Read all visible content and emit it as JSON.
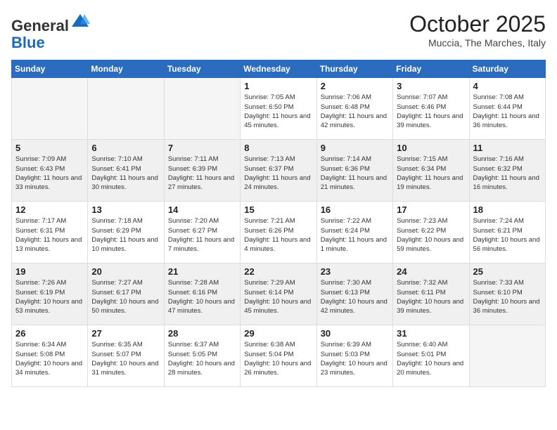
{
  "header": {
    "logo_line1": "General",
    "logo_line2": "Blue",
    "month_title": "October 2025",
    "location": "Muccia, The Marches, Italy"
  },
  "weekdays": [
    "Sunday",
    "Monday",
    "Tuesday",
    "Wednesday",
    "Thursday",
    "Friday",
    "Saturday"
  ],
  "weeks": [
    {
      "shaded": false,
      "days": [
        {
          "num": "",
          "info": ""
        },
        {
          "num": "",
          "info": ""
        },
        {
          "num": "",
          "info": ""
        },
        {
          "num": "1",
          "info": "Sunrise: 7:05 AM\nSunset: 6:50 PM\nDaylight: 11 hours and 45 minutes."
        },
        {
          "num": "2",
          "info": "Sunrise: 7:06 AM\nSunset: 6:48 PM\nDaylight: 11 hours and 42 minutes."
        },
        {
          "num": "3",
          "info": "Sunrise: 7:07 AM\nSunset: 6:46 PM\nDaylight: 11 hours and 39 minutes."
        },
        {
          "num": "4",
          "info": "Sunrise: 7:08 AM\nSunset: 6:44 PM\nDaylight: 11 hours and 36 minutes."
        }
      ]
    },
    {
      "shaded": true,
      "days": [
        {
          "num": "5",
          "info": "Sunrise: 7:09 AM\nSunset: 6:43 PM\nDaylight: 11 hours and 33 minutes."
        },
        {
          "num": "6",
          "info": "Sunrise: 7:10 AM\nSunset: 6:41 PM\nDaylight: 11 hours and 30 minutes."
        },
        {
          "num": "7",
          "info": "Sunrise: 7:11 AM\nSunset: 6:39 PM\nDaylight: 11 hours and 27 minutes."
        },
        {
          "num": "8",
          "info": "Sunrise: 7:13 AM\nSunset: 6:37 PM\nDaylight: 11 hours and 24 minutes."
        },
        {
          "num": "9",
          "info": "Sunrise: 7:14 AM\nSunset: 6:36 PM\nDaylight: 11 hours and 21 minutes."
        },
        {
          "num": "10",
          "info": "Sunrise: 7:15 AM\nSunset: 6:34 PM\nDaylight: 11 hours and 19 minutes."
        },
        {
          "num": "11",
          "info": "Sunrise: 7:16 AM\nSunset: 6:32 PM\nDaylight: 11 hours and 16 minutes."
        }
      ]
    },
    {
      "shaded": false,
      "days": [
        {
          "num": "12",
          "info": "Sunrise: 7:17 AM\nSunset: 6:31 PM\nDaylight: 11 hours and 13 minutes."
        },
        {
          "num": "13",
          "info": "Sunrise: 7:18 AM\nSunset: 6:29 PM\nDaylight: 11 hours and 10 minutes."
        },
        {
          "num": "14",
          "info": "Sunrise: 7:20 AM\nSunset: 6:27 PM\nDaylight: 11 hours and 7 minutes."
        },
        {
          "num": "15",
          "info": "Sunrise: 7:21 AM\nSunset: 6:26 PM\nDaylight: 11 hours and 4 minutes."
        },
        {
          "num": "16",
          "info": "Sunrise: 7:22 AM\nSunset: 6:24 PM\nDaylight: 11 hours and 1 minute."
        },
        {
          "num": "17",
          "info": "Sunrise: 7:23 AM\nSunset: 6:22 PM\nDaylight: 10 hours and 59 minutes."
        },
        {
          "num": "18",
          "info": "Sunrise: 7:24 AM\nSunset: 6:21 PM\nDaylight: 10 hours and 56 minutes."
        }
      ]
    },
    {
      "shaded": true,
      "days": [
        {
          "num": "19",
          "info": "Sunrise: 7:26 AM\nSunset: 6:19 PM\nDaylight: 10 hours and 53 minutes."
        },
        {
          "num": "20",
          "info": "Sunrise: 7:27 AM\nSunset: 6:17 PM\nDaylight: 10 hours and 50 minutes."
        },
        {
          "num": "21",
          "info": "Sunrise: 7:28 AM\nSunset: 6:16 PM\nDaylight: 10 hours and 47 minutes."
        },
        {
          "num": "22",
          "info": "Sunrise: 7:29 AM\nSunset: 6:14 PM\nDaylight: 10 hours and 45 minutes."
        },
        {
          "num": "23",
          "info": "Sunrise: 7:30 AM\nSunset: 6:13 PM\nDaylight: 10 hours and 42 minutes."
        },
        {
          "num": "24",
          "info": "Sunrise: 7:32 AM\nSunset: 6:11 PM\nDaylight: 10 hours and 39 minutes."
        },
        {
          "num": "25",
          "info": "Sunrise: 7:33 AM\nSunset: 6:10 PM\nDaylight: 10 hours and 36 minutes."
        }
      ]
    },
    {
      "shaded": false,
      "days": [
        {
          "num": "26",
          "info": "Sunrise: 6:34 AM\nSunset: 5:08 PM\nDaylight: 10 hours and 34 minutes."
        },
        {
          "num": "27",
          "info": "Sunrise: 6:35 AM\nSunset: 5:07 PM\nDaylight: 10 hours and 31 minutes."
        },
        {
          "num": "28",
          "info": "Sunrise: 6:37 AM\nSunset: 5:05 PM\nDaylight: 10 hours and 28 minutes."
        },
        {
          "num": "29",
          "info": "Sunrise: 6:38 AM\nSunset: 5:04 PM\nDaylight: 10 hours and 26 minutes."
        },
        {
          "num": "30",
          "info": "Sunrise: 6:39 AM\nSunset: 5:03 PM\nDaylight: 10 hours and 23 minutes."
        },
        {
          "num": "31",
          "info": "Sunrise: 6:40 AM\nSunset: 5:01 PM\nDaylight: 10 hours and 20 minutes."
        },
        {
          "num": "",
          "info": ""
        }
      ]
    }
  ]
}
